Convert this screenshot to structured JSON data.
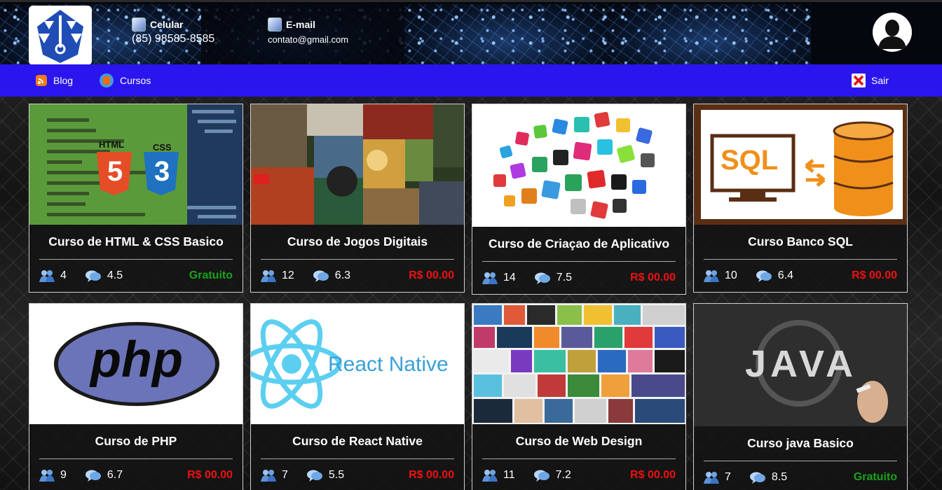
{
  "header": {
    "phone": {
      "title": "Celular",
      "value": "(85) 98585-8585",
      "icon": "phone-icon"
    },
    "email": {
      "title": "E-mail",
      "value": "contato@gmail.com",
      "icon": "email-icon"
    }
  },
  "nav": {
    "blog": "Blog",
    "courses": "Cursos",
    "logout": "Sair"
  },
  "colors": {
    "nav_bg": "#2a15ee",
    "free": "#1aa21a",
    "paid": "#ee1111"
  },
  "courses": [
    {
      "title": "Curso de HTML & CSS Basico",
      "students": "4",
      "rating": "4.5",
      "price": "Gratuito",
      "free": true,
      "image": "html-css-image"
    },
    {
      "title": "Curso de Jogos Digitais",
      "students": "12",
      "rating": "6.3",
      "price": "R$ 00.00",
      "free": false,
      "image": "games-collage-image"
    },
    {
      "title": "Curso de Criaçao de Aplicativo",
      "students": "14",
      "rating": "7.5",
      "price": "R$ 00.00",
      "free": false,
      "image": "app-icons-image"
    },
    {
      "title": "Curso Banco SQL",
      "students": "10",
      "rating": "6.4",
      "price": "R$ 00.00",
      "free": false,
      "image": "sql-database-image"
    },
    {
      "title": "Curso de PHP",
      "students": "9",
      "rating": "6.7",
      "price": "R$ 00.00",
      "free": false,
      "image": "php-logo-image"
    },
    {
      "title": "Curso de React Native",
      "students": "7",
      "rating": "5.5",
      "price": "R$ 00.00",
      "free": false,
      "image": "react-native-logo-image"
    },
    {
      "title": "Curso de Web Design",
      "students": "11",
      "rating": "7.2",
      "price": "R$ 00.00",
      "free": false,
      "image": "web-design-collage-image"
    },
    {
      "title": "Curso java Basico",
      "students": "7",
      "rating": "8.5",
      "price": "Gratuito",
      "free": true,
      "image": "java-chalkboard-image"
    }
  ],
  "images_text": {
    "html_badge": "HTML",
    "html_num": "5",
    "css_badge": "CSS",
    "css_num": "3",
    "sql_label": "SQL",
    "php_label": "php",
    "react_label": "React Native",
    "java_label": "JAVA"
  }
}
